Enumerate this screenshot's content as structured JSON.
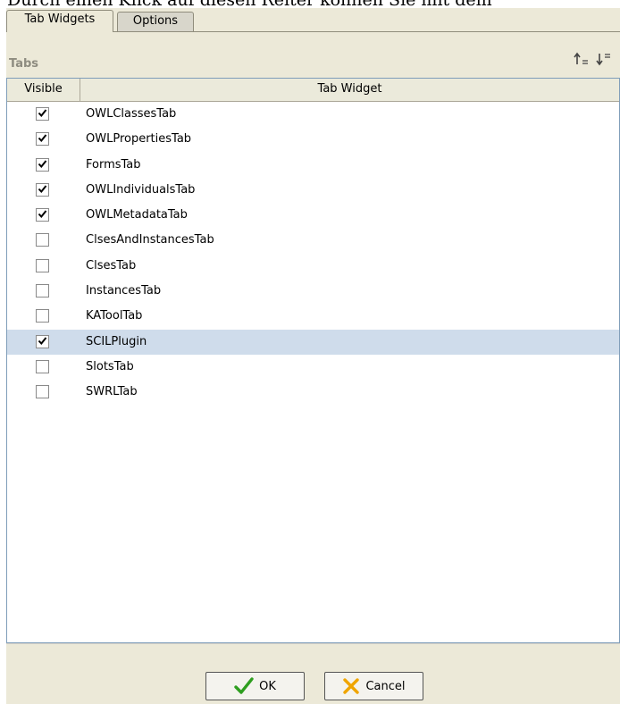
{
  "page": {
    "cutoff_text": "Durch einen Klick auf diesen Reiter können Sie mit dem"
  },
  "tabs": [
    {
      "label": "Tab Widgets",
      "active": true
    },
    {
      "label": "Options",
      "active": false
    }
  ],
  "panel": {
    "title": "Tabs",
    "sort_up_icon": "move-up-icon",
    "sort_down_icon": "move-down-icon"
  },
  "table": {
    "columns": [
      "Visible",
      "Tab Widget"
    ],
    "rows": [
      {
        "name": "OWLClassesTab",
        "visible": true,
        "selected": false
      },
      {
        "name": "OWLPropertiesTab",
        "visible": true,
        "selected": false
      },
      {
        "name": "FormsTab",
        "visible": true,
        "selected": false
      },
      {
        "name": "OWLIndividualsTab",
        "visible": true,
        "selected": false
      },
      {
        "name": "OWLMetadataTab",
        "visible": true,
        "selected": false
      },
      {
        "name": "ClsesAndInstancesTab",
        "visible": false,
        "selected": false
      },
      {
        "name": "ClsesTab",
        "visible": false,
        "selected": false
      },
      {
        "name": "InstancesTab",
        "visible": false,
        "selected": false
      },
      {
        "name": "KAToolTab",
        "visible": false,
        "selected": false
      },
      {
        "name": "SCILPlugin",
        "visible": true,
        "selected": true
      },
      {
        "name": "SlotsTab",
        "visible": false,
        "selected": false
      },
      {
        "name": "SWRLTab",
        "visible": false,
        "selected": false
      }
    ]
  },
  "buttons": {
    "ok_label": "OK",
    "cancel_label": "Cancel"
  },
  "colors": {
    "selection": "#cfdceb",
    "ok_check": "#2e9e1f",
    "cancel_x": "#f0a500"
  }
}
